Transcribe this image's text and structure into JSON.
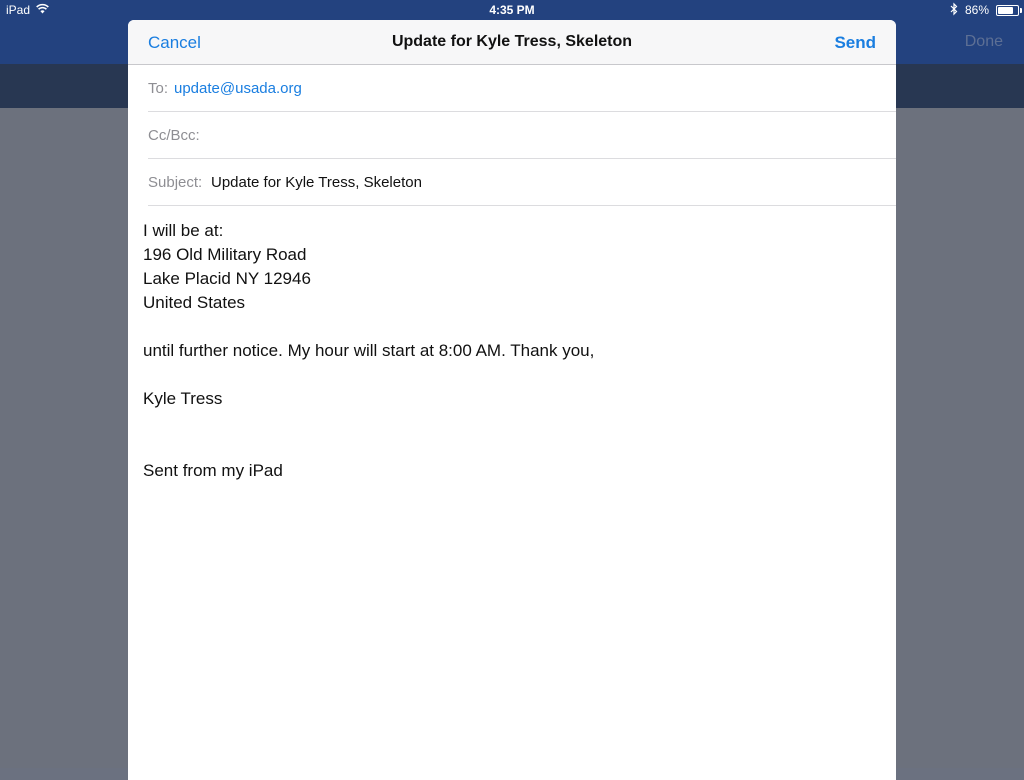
{
  "status_bar": {
    "device": "iPad",
    "time": "4:35 PM",
    "battery_percent": "86%",
    "battery_level": 0.86
  },
  "background": {
    "done_label": "Done"
  },
  "compose": {
    "cancel_label": "Cancel",
    "title": "Update for Kyle Tress, Skeleton",
    "send_label": "Send",
    "to_label": "To:",
    "to_value": "update@usada.org",
    "ccbcc_label": "Cc/Bcc:",
    "subject_label": "Subject:",
    "subject_value": "Update for Kyle Tress, Skeleton",
    "body_lines": [
      "I will be at:",
      "196 Old Military Road",
      "Lake Placid NY 12946",
      "United States",
      "",
      "until further notice. My hour will start at 8:00 AM. Thank you,",
      "",
      "Kyle Tress",
      "",
      "",
      "Sent from my iPad"
    ]
  },
  "colors": {
    "accent": "#1a7ee0",
    "nav_bar": "#23427f",
    "dim_overlay": "#6c717d"
  }
}
